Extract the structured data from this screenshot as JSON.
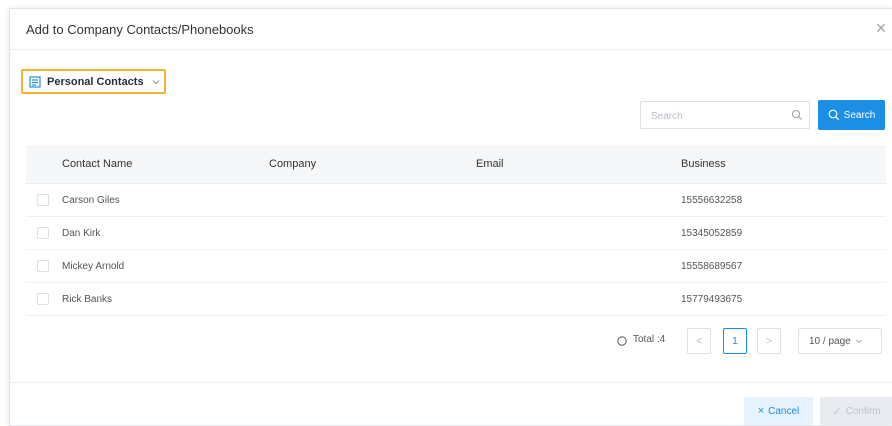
{
  "dialog": {
    "title": "Add to Company Contacts/Phonebooks",
    "close_icon": "close-icon",
    "close_glyph": "×"
  },
  "source_select": {
    "icon": "contact-book-icon",
    "label": "Personal Contacts",
    "highlight_color": "#f2b233"
  },
  "search": {
    "placeholder": "Search",
    "value": "",
    "button_label": "Search",
    "accent_color": "#1a8fe5"
  },
  "table": {
    "columns": [
      "Contact Name",
      "Company",
      "Email",
      "Business"
    ],
    "rows": [
      {
        "name": "Carson Giles",
        "company": "",
        "email": "",
        "business": "15556632258"
      },
      {
        "name": "Dan Kirk",
        "company": "",
        "email": "",
        "business": "15345052859"
      },
      {
        "name": "Mickey Arnold",
        "company": "",
        "email": "",
        "business": "15558689567"
      },
      {
        "name": "Rick Banks",
        "company": "",
        "email": "",
        "business": "15779493675"
      }
    ]
  },
  "pagination": {
    "total": "Total :4",
    "prev_glyph": "<",
    "current_page": "1",
    "next_glyph": ">",
    "page_size": "10 / page"
  },
  "footer": {
    "cancel_label": "Cancel",
    "cancel_glyph": "×",
    "confirm_label": "Confirm",
    "confirm_glyph": "✓"
  }
}
